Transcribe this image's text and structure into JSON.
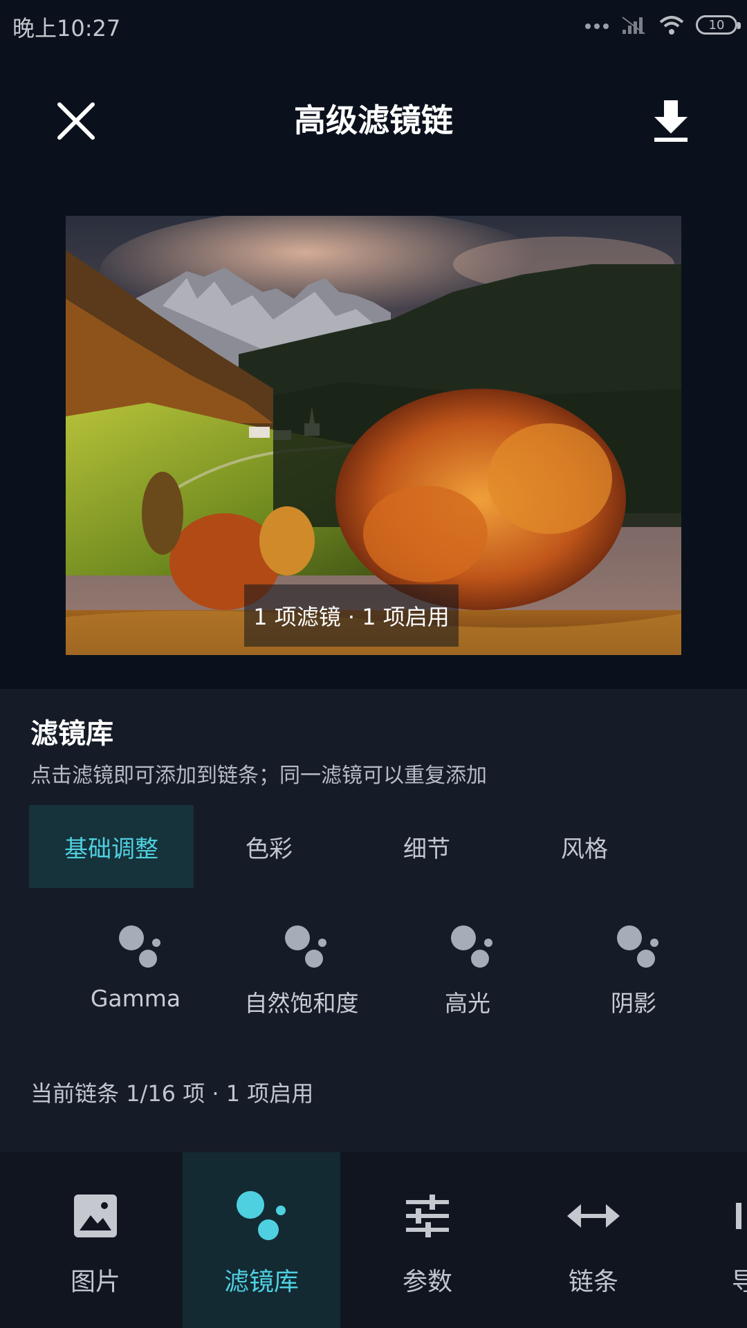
{
  "status_bar": {
    "time": "晚上10:27",
    "battery": "10"
  },
  "header": {
    "title": "高级滤镜链"
  },
  "preview": {
    "badge": "1 项滤镜 · 1 项启用"
  },
  "library": {
    "title": "滤镜库",
    "subtitle": "点击滤镜即可添加到链条；同一滤镜可以重复添加",
    "tabs": [
      "基础调整",
      "色彩",
      "细节",
      "风格"
    ],
    "active_tab": "基础调整",
    "filters": [
      {
        "label": "Gamma",
        "icon": "filter-dots-icon"
      },
      {
        "label": "自然饱和度",
        "icon": "filter-dots-icon"
      },
      {
        "label": "高光",
        "icon": "filter-dots-icon"
      },
      {
        "label": "阴影",
        "icon": "filter-dots-icon"
      }
    ],
    "chain_status": "当前链条 1/16 项 · 1 项启用"
  },
  "bottom_nav": {
    "items": [
      {
        "label": "图片",
        "icon": "image-icon"
      },
      {
        "label": "滤镜库",
        "icon": "filter-dots-icon"
      },
      {
        "label": "参数",
        "icon": "sliders-icon"
      },
      {
        "label": "链条",
        "icon": "swap-arrows-icon"
      },
      {
        "label": "导",
        "icon": "export-icon"
      }
    ],
    "active": "滤镜库"
  },
  "colors": {
    "accent": "#4fd0e0",
    "background": "#0b111c",
    "panel": "#151b27",
    "active_tab_bg": "#16323a"
  }
}
